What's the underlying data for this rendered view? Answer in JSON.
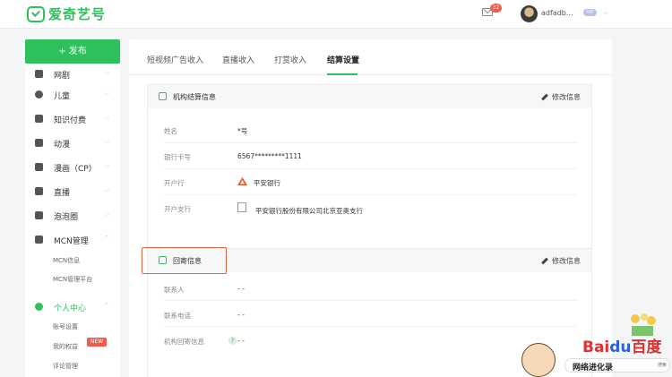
{
  "header": {
    "logo_text": "爱奇艺号",
    "mail_count": "32",
    "username": "adfadb...",
    "vip_label": "VIP",
    "caret": "⌵"
  },
  "sidebar": {
    "publish_label": "+ 发布",
    "items": [
      {
        "label": "网剧",
        "icon": "video-icon"
      },
      {
        "label": "儿童",
        "icon": "child-icon"
      },
      {
        "label": "知识付费",
        "icon": "graduation-cap-icon"
      },
      {
        "label": "动漫",
        "icon": "cat-icon"
      },
      {
        "label": "漫画（CP）",
        "icon": "comic-icon"
      },
      {
        "label": "直播",
        "icon": "live-tv-icon"
      },
      {
        "label": "泡泡圈",
        "icon": "bubble-icon"
      },
      {
        "label": "MCN管理",
        "icon": "mcn-icon"
      },
      {
        "label": "个人中心",
        "icon": "user-icon"
      }
    ],
    "mcn_sub": [
      "MCN信息",
      "MCN管理平台"
    ],
    "personal_sub": [
      "账号设置",
      "我的权益",
      "评论管理"
    ],
    "new_badge": "NEW"
  },
  "main": {
    "tabs": [
      "短视频广告收入",
      "直播收入",
      "打赏收入",
      "结算设置"
    ],
    "active_tab": "结算设置",
    "settlement_panel": {
      "title": "机构结算信息",
      "edit_label": "修改信息",
      "rows": [
        {
          "label": "姓名",
          "value": "*号"
        },
        {
          "label": "银行卡号",
          "value": "6567*********1111"
        },
        {
          "label": "开户行",
          "value": "平安银行"
        },
        {
          "label": "开户支行",
          "value": "平安银行股份有限公司北京亚奥支行"
        }
      ]
    },
    "mail_panel": {
      "title": "回寄信息",
      "edit_label": "修改信息",
      "rows": [
        {
          "label": "联系人",
          "value": "- -"
        },
        {
          "label": "联系电话",
          "value": "- -"
        },
        {
          "label": "机构回寄信息",
          "value": "- -"
        }
      ]
    }
  },
  "watermark": {
    "brand_prefix": "Bai",
    "brand_du": "du",
    "brand_cn": "百度",
    "search_text": "网络进化录",
    "search_button": "搜索"
  },
  "colors": {
    "accent": "#2ec05c",
    "highlight_border": "#d9683f",
    "badge": "#f25a4b"
  }
}
